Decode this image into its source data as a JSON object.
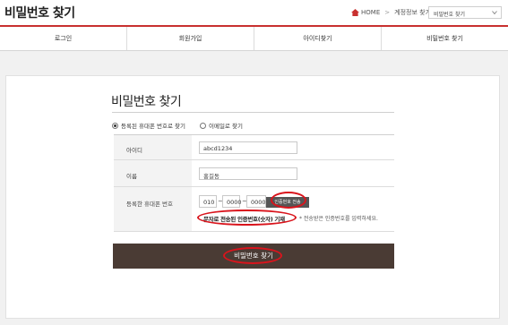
{
  "header": {
    "title": "비밀번호 찾기",
    "breadcrumb": {
      "home": "HOME",
      "section": "계정정보 찾기",
      "current": "비밀번호 찾기"
    }
  },
  "nav": {
    "items": [
      "로그인",
      "회원가입",
      "아이디찾기",
      "비밀번호 찾기"
    ]
  },
  "form": {
    "title": "비밀번호 찾기",
    "method_options": [
      "등록된 휴대폰 번호로 찾기",
      "이메일로 찾기"
    ],
    "selected_method": "등록된 휴대폰 번호로 찾기",
    "id_label": "아이디",
    "id_value": "abcd1234",
    "name_label": "이름",
    "name_value": "홍길동",
    "phone_label": "등록한 휴대폰 번호",
    "phone_1": "010",
    "phone_2": "0000",
    "phone_3": "0000",
    "tilde": "~",
    "send_code_label": "인증번호 전송",
    "code_placeholder": "문자로 전송된 인증번호(숫자) 기재",
    "code_hint": "* 전송받은 인증번호를 입력하세요.",
    "submit_label": "비밀번호 찾기"
  },
  "colors": {
    "accent": "#c8302f",
    "submit_bg": "#4a3b34",
    "highlight": "#d9141c"
  }
}
